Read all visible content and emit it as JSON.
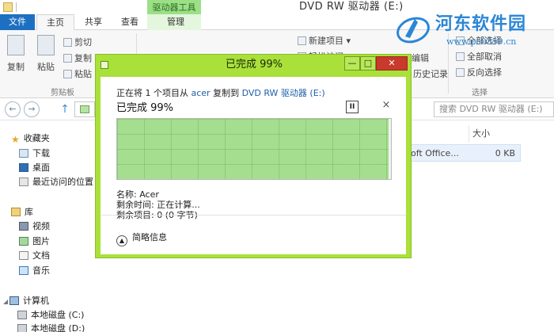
{
  "window": {
    "context_tab": "驱动器工具",
    "title": "DVD RW 驱动器 (E:)"
  },
  "tabs": {
    "file": "文件",
    "home": "主页",
    "share": "共享",
    "view": "查看",
    "manage": "管理"
  },
  "ribbon": {
    "copy": "复制",
    "paste": "粘贴",
    "cut": "剪切",
    "copy_path": "复制",
    "paste_shortcut": "粘贴",
    "clipboard_group": "剪贴板",
    "new_item": "新建项目",
    "easy_access": "轻松访问",
    "edit": "编辑",
    "history": "历史记录",
    "select_all": "全部选择",
    "select_none": "全部取消",
    "invert_selection": "反向选择",
    "select_group": "选择"
  },
  "watermark": {
    "name": "河东软件园",
    "url": "www.pc0359.cn"
  },
  "address": {
    "back": "←",
    "forward": "→",
    "up": "↑",
    "search_placeholder": "搜索 DVD RW 驱动器 (E:)"
  },
  "nav": {
    "favorites": "收藏夹",
    "downloads": "下载",
    "desktop": "桌面",
    "recent": "最近访问的位置",
    "libraries": "库",
    "videos": "视频",
    "pictures": "图片",
    "documents": "文档",
    "music": "音乐",
    "computer": "计算机",
    "local_c": "本地磁盘 (C:)",
    "local_d": "本地磁盘 (D:)"
  },
  "filelist": {
    "size_header": "大小",
    "row_name": "oft Office...",
    "row_size": "0 KB"
  },
  "dialog": {
    "title": "已完成 99%",
    "line_prefix": "正在将 1 个项目从",
    "source": "acer",
    "line_mid": "复制到",
    "destination": "DVD RW 驱动器 (E:)",
    "percent_text": "已完成 99%",
    "progress_percent": 99,
    "name_label": "名称: Acer",
    "time_label": "剩余时间: 正在计算...",
    "items_label": "剩余项目: 0 (0 字节)",
    "more_label": "简略信息",
    "pause_glyph": "II",
    "close_glyph": "×",
    "min_glyph": "—",
    "max_glyph": "□",
    "winclose_glyph": "✕"
  },
  "colors": {
    "accent": "#a9e03a",
    "progress": "#a6de8f",
    "file_tab": "#1d6fc2",
    "link": "#1f5fa8"
  }
}
